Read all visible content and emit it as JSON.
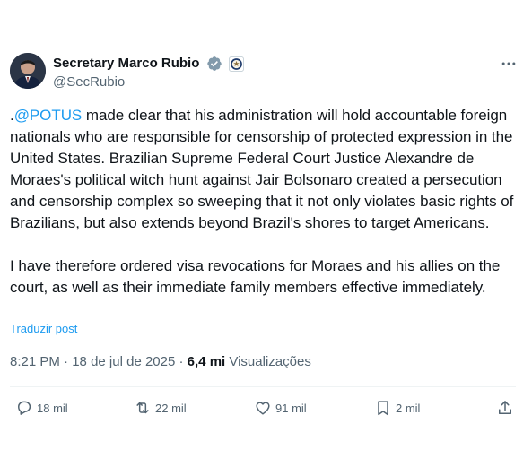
{
  "author": {
    "name": "Secretary Marco Rubio",
    "handle": "@SecRubio"
  },
  "post": {
    "prefix": ".",
    "mention": "@POTUS",
    "p1_rest": " made clear that his administration will hold accountable foreign nationals who are responsible for censorship of protected expression in the United States. Brazilian Supreme Federal Court Justice Alexandre de Moraes's political witch hunt against Jair Bolsonaro created a persecution and censorship complex so sweeping that it not only violates basic rights of Brazilians, but also extends beyond Brazil's shores to target Americans.",
    "p2": "I have therefore ordered visa revocations for Moraes and his allies on the court, as well as their immediate family members effective immediately.",
    "translate_label": "Traduzir post"
  },
  "meta": {
    "time": "8:21 PM",
    "separator": " · ",
    "date": "18 de jul de 2025",
    "separator2": " · ",
    "views_count": "6,4 mi",
    "views_label": " Visualizações"
  },
  "actions": {
    "replies": "18 mil",
    "reposts": "22 mil",
    "likes": "91 mil",
    "bookmarks": "2 mil"
  },
  "colors": {
    "accent": "#1d9bf0",
    "text": "#0f1419",
    "muted": "#536471",
    "divider": "#eff3f4"
  },
  "icons": [
    "verified-badge-icon",
    "government-seal-icon",
    "more-options-icon",
    "reply-icon",
    "repost-icon",
    "like-icon",
    "bookmark-icon",
    "share-icon"
  ]
}
